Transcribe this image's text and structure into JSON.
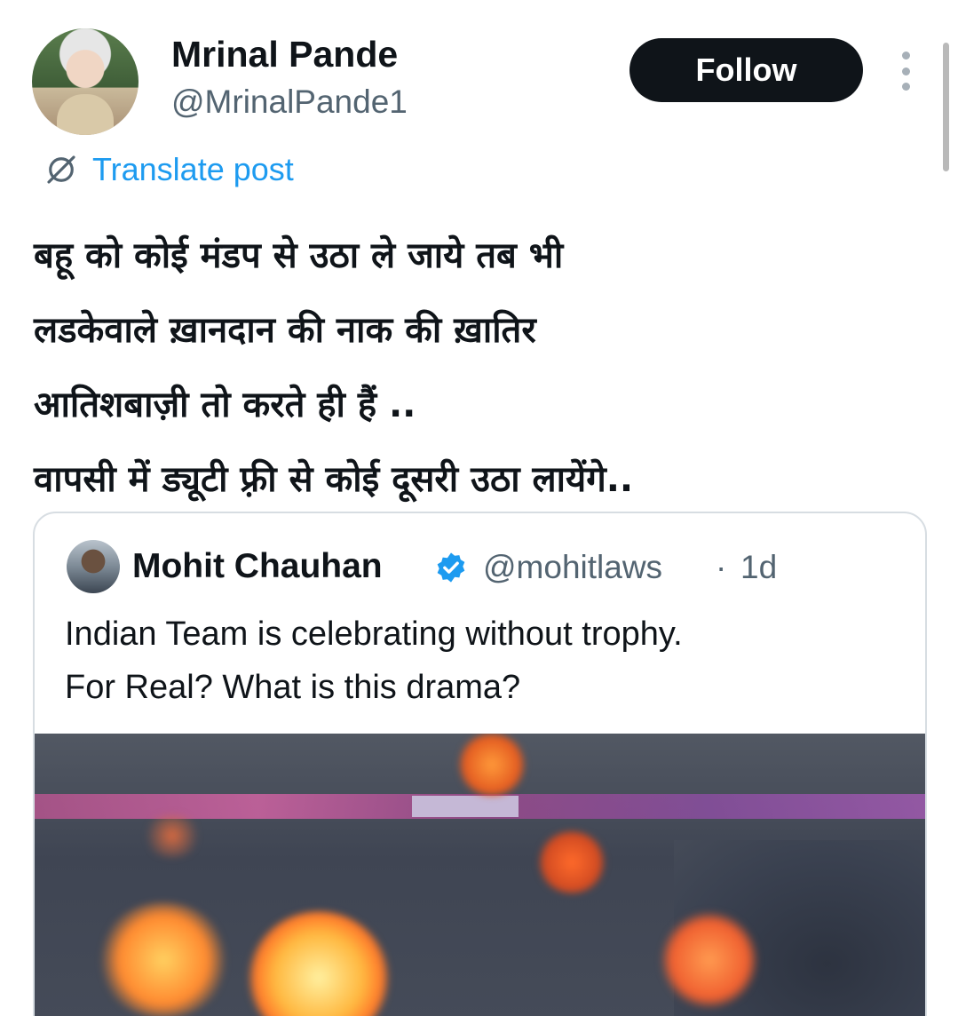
{
  "post": {
    "author_name": "Mrinal Pande",
    "author_handle": "@MrinalPande1",
    "follow_label": "Follow",
    "translate_label": "Translate post",
    "text_lines": [
      "बहू को कोई मंडप से उठा ले जाये तब भी",
      "लडकेवाले ख़ानदान की नाक की ख़ातिर",
      "आतिशबाज़ी तो करते ही हैं ..",
      "वापसी में ड्यूटी फ़्री से कोई दूसरी उठा लायेंगे.."
    ]
  },
  "quoted": {
    "author_name": "Mohit Chauhan",
    "author_handle": "@mohitlaws",
    "separator": "·",
    "time": "1d",
    "text_lines": [
      "Indian Team is celebrating without trophy.",
      "For Real? What is this drama?"
    ],
    "verified": true
  },
  "colors": {
    "text_primary": "#0f1419",
    "text_secondary": "#536471",
    "link": "#1d9bf0",
    "follow_bg": "#0f1419",
    "border": "#d7dde2",
    "verified": "#1d9bf0"
  },
  "icons": {
    "translate": "globe-slash-icon",
    "more": "vertical-ellipsis-icon",
    "verified": "verified-badge-icon"
  }
}
